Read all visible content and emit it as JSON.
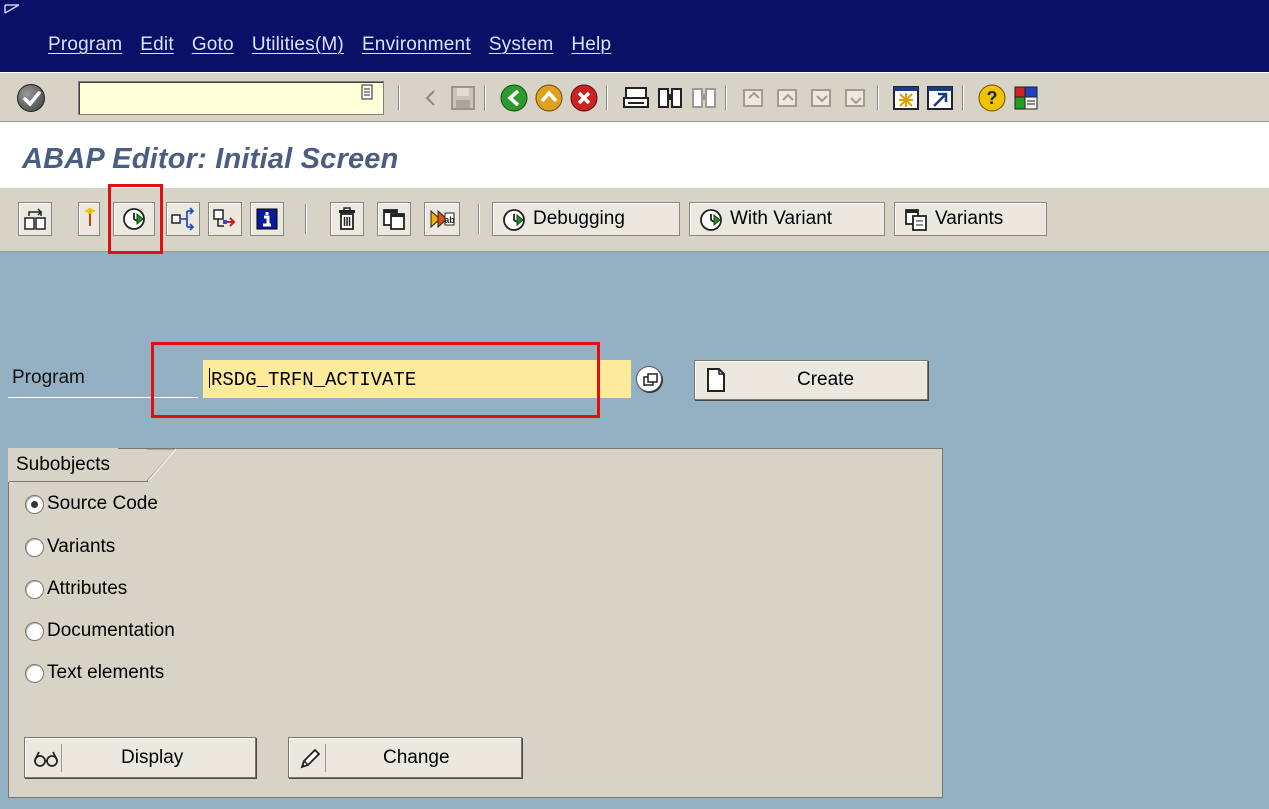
{
  "menu": [
    "Program",
    "Edit",
    "Goto",
    "Utilities(M)",
    "Environment",
    "System",
    "Help"
  ],
  "command_field": {
    "value": ""
  },
  "title": "ABAP Editor: Initial Screen",
  "app_toolbar": {
    "debugging": "Debugging",
    "with_variant": "With Variant",
    "variants": "Variants"
  },
  "program": {
    "label": "Program",
    "value": "RSDG_TRFN_ACTIVATE",
    "create": "Create"
  },
  "subobjects": {
    "title": "Subobjects",
    "options": [
      {
        "label": "Source Code",
        "checked": true
      },
      {
        "label": "Variants",
        "checked": false
      },
      {
        "label": "Attributes",
        "checked": false
      },
      {
        "label": "Documentation",
        "checked": false
      },
      {
        "label": "Text elements",
        "checked": false
      }
    ],
    "display": "Display",
    "change": "Change"
  },
  "colors": {
    "menubar": "#0a1066",
    "background": "#94b1c4",
    "title": "#4a5e82",
    "input": "#fdea9b",
    "highlight": "#e01010"
  },
  "icons": {
    "system_toolbar": [
      "enter-icon",
      "history-icon",
      "back-arrow-icon",
      "save-icon",
      "back-icon",
      "exit-icon",
      "cancel-icon",
      "print-icon",
      "find-icon",
      "find-next-icon",
      "first-page-icon",
      "previous-page-icon",
      "next-page-icon",
      "last-page-icon",
      "new-session-icon",
      "shortcut-icon",
      "help-icon",
      "layout-menu-icon"
    ],
    "app_toolbar": [
      "other-object-icon",
      "check-icon",
      "execute-icon",
      "where-used-icon",
      "activate-icon",
      "info-icon",
      "delete-icon",
      "copy-icon",
      "rename-icon"
    ]
  }
}
